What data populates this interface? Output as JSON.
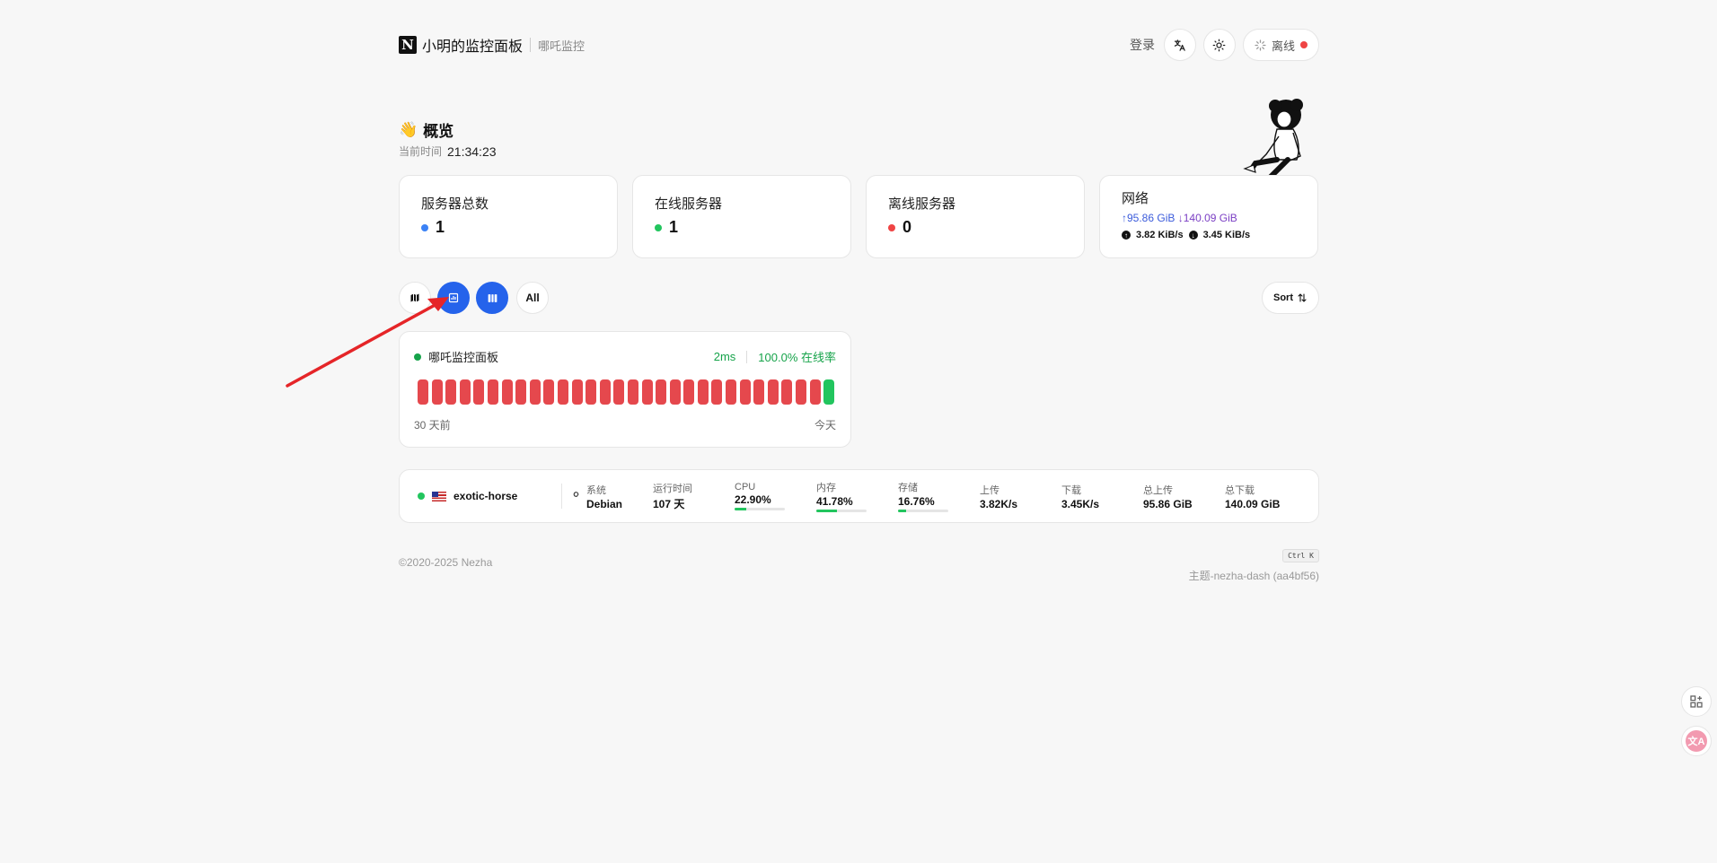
{
  "header": {
    "logo_letter": "N",
    "title": "小明的监控面板",
    "subtitle": "哪吒监控",
    "login": "登录",
    "status": "离线",
    "status_color": "#ef4444"
  },
  "overview": {
    "emoji": "👋",
    "title": "概览",
    "time_label": "当前时间",
    "time_value": "21:34:23"
  },
  "cards": {
    "total": {
      "label": "服务器总数",
      "value": "1",
      "dot": "#3b82f6"
    },
    "online": {
      "label": "在线服务器",
      "value": "1",
      "dot": "#22c55e"
    },
    "offline": {
      "label": "离线服务器",
      "value": "0",
      "dot": "#ef4444"
    },
    "network": {
      "label": "网络",
      "up_total": "↑95.86 GiB",
      "down_total": "↓140.09 GiB",
      "up_speed": "3.82 KiB/s",
      "down_speed": "3.45 KiB/s"
    }
  },
  "filters": {
    "all_label": "All",
    "sort_label": "Sort",
    "icons": [
      "map-icon",
      "chart-icon",
      "columns-icon"
    ]
  },
  "monitor": {
    "name": "哪吒监控面板",
    "latency": "2ms",
    "uptime": "100.0% 在线率",
    "from_label": "30 天前",
    "to_label": "今天",
    "history": [
      "down",
      "down",
      "down",
      "down",
      "down",
      "down",
      "down",
      "down",
      "down",
      "down",
      "down",
      "down",
      "down",
      "down",
      "down",
      "down",
      "down",
      "down",
      "down",
      "down",
      "down",
      "down",
      "down",
      "down",
      "down",
      "down",
      "down",
      "down",
      "down",
      "up"
    ]
  },
  "server": {
    "name": "exotic-horse",
    "system_label": "系统",
    "system_value": "Debian",
    "uptime_label": "运行时间",
    "uptime_value": "107 天",
    "cpu_label": "CPU",
    "cpu_value": "22.90%",
    "cpu_fraction": 0.229,
    "mem_label": "内存",
    "mem_value": "41.78%",
    "mem_fraction": 0.4178,
    "disk_label": "存储",
    "disk_value": "16.76%",
    "disk_fraction": 0.1676,
    "up_label": "上传",
    "up_value": "3.82K/s",
    "down_label": "下载",
    "down_value": "3.45K/s",
    "total_up_label": "总上传",
    "total_up_value": "95.86 GiB",
    "total_down_label": "总下载",
    "total_down_value": "140.09 GiB"
  },
  "footer": {
    "copyright": "©2020-2025 Nezha",
    "shortcut": "Ctrl K",
    "theme": "主题-nezha-dash (aa4bf56)"
  }
}
